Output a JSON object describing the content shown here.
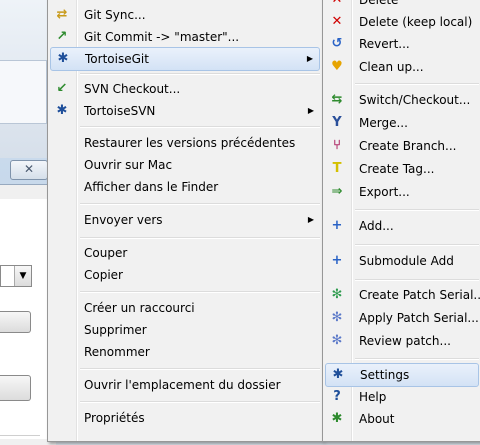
{
  "context_menu": {
    "items": [
      {
        "label": "Git Sync...",
        "icon": "git-sync-icon"
      },
      {
        "label": "Git Commit -> \"master\"...",
        "icon": "git-commit-icon"
      },
      {
        "label": "TortoiseGit",
        "icon": "tortoisegit-icon"
      },
      {
        "label": "SVN Checkout...",
        "icon": "svn-checkout-icon"
      },
      {
        "label": "TortoiseSVN",
        "icon": "tortoisesvn-icon"
      },
      {
        "label": "Restaurer les versions précédentes"
      },
      {
        "label": "Ouvrir sur Mac"
      },
      {
        "label": "Afficher dans le Finder"
      },
      {
        "label": "Envoyer vers"
      },
      {
        "label": "Couper"
      },
      {
        "label": "Copier"
      },
      {
        "label": "Créer un raccourci"
      },
      {
        "label": "Supprimer"
      },
      {
        "label": "Renommer"
      },
      {
        "label": "Ouvrir l'emplacement du dossier"
      },
      {
        "label": "Propriétés"
      }
    ]
  },
  "submenu": {
    "items": [
      {
        "label": "Delete",
        "icon": "delete-icon"
      },
      {
        "label": "Delete (keep local)",
        "icon": "delete-keep-local-icon"
      },
      {
        "label": "Revert...",
        "icon": "revert-icon"
      },
      {
        "label": "Clean up...",
        "icon": "clean-up-icon"
      },
      {
        "label": "Switch/Checkout...",
        "icon": "switch-checkout-icon"
      },
      {
        "label": "Merge...",
        "icon": "merge-icon"
      },
      {
        "label": "Create Branch...",
        "icon": "create-branch-icon"
      },
      {
        "label": "Create Tag...",
        "icon": "create-tag-icon"
      },
      {
        "label": "Export...",
        "icon": "export-icon"
      },
      {
        "label": "Add...",
        "icon": "add-icon"
      },
      {
        "label": "Submodule Add",
        "icon": "submodule-add-icon"
      },
      {
        "label": "Create Patch Serial...",
        "icon": "create-patch-serial-icon"
      },
      {
        "label": "Apply Patch Serial...",
        "icon": "apply-patch-serial-icon"
      },
      {
        "label": "Review patch...",
        "icon": "review-patch-icon"
      },
      {
        "label": "Settings",
        "icon": "settings-icon"
      },
      {
        "label": "Help",
        "icon": "help-icon"
      },
      {
        "label": "About",
        "icon": "about-icon"
      }
    ]
  },
  "background_window": {
    "close_glyph": "✕",
    "combo_arrow": "▼"
  },
  "colors": {
    "menu_bg": "#f1f1f1",
    "highlight": "#d3e2f5",
    "highlight_border": "#a8c4e6",
    "delete_red": "#d00000"
  }
}
